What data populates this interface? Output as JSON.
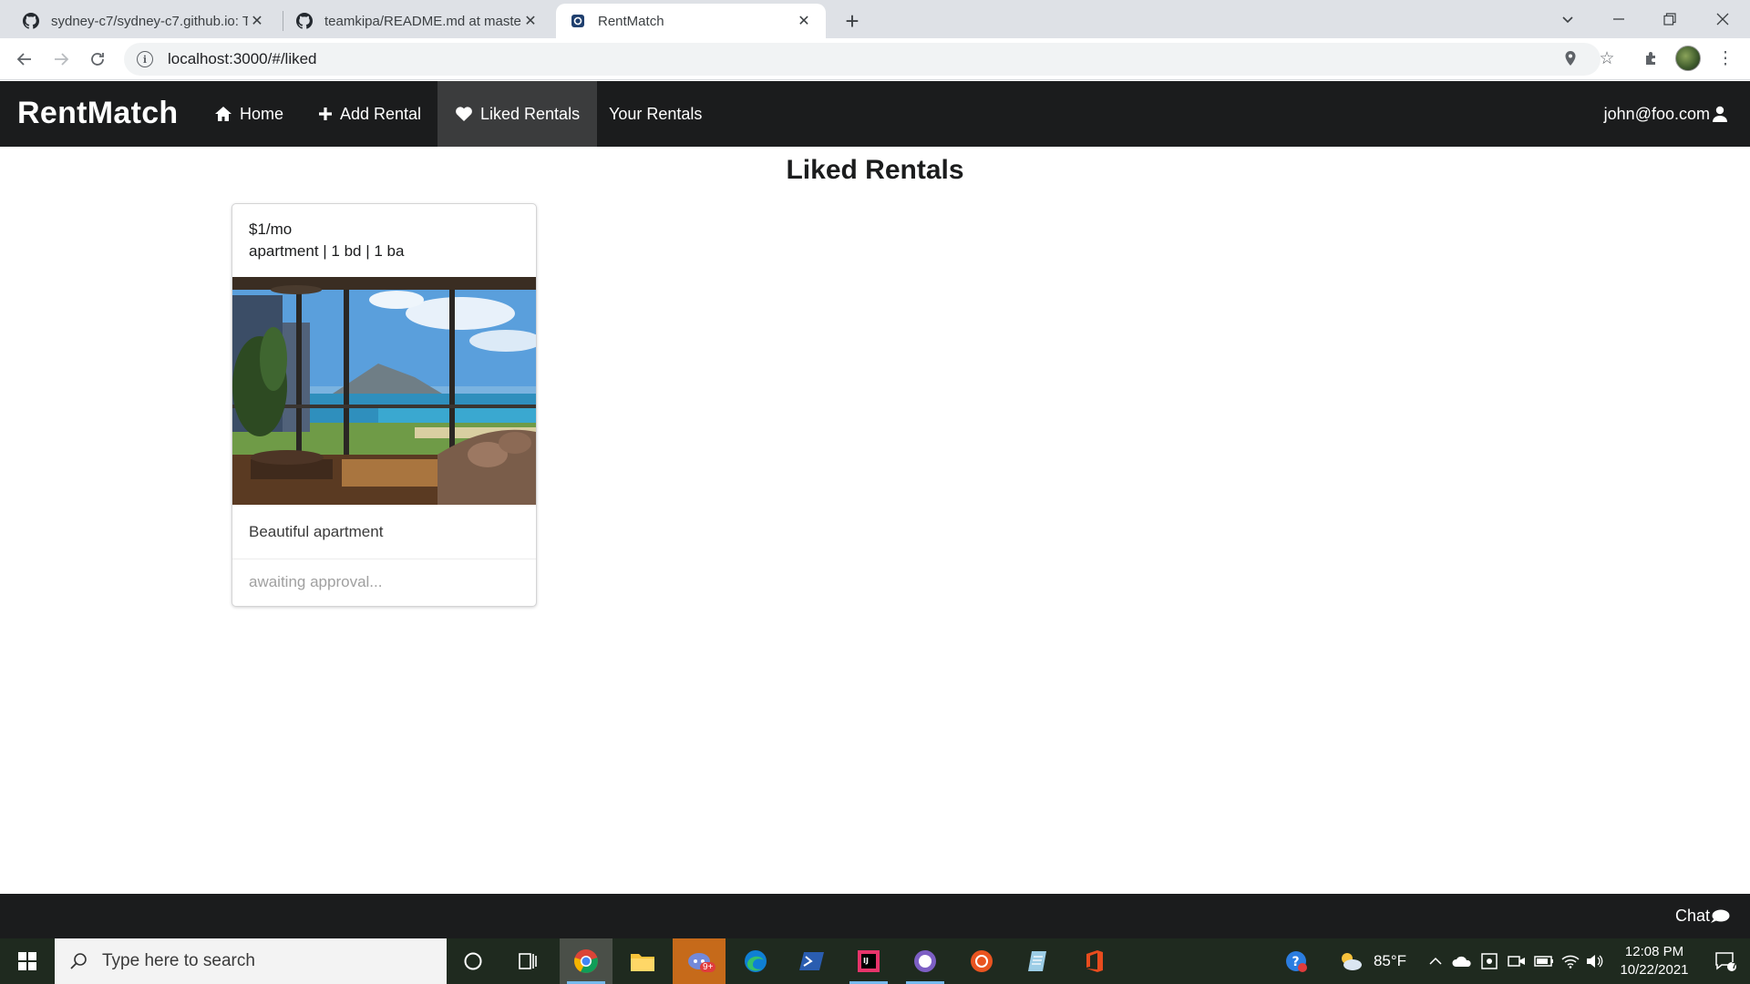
{
  "browser": {
    "tabs": [
      {
        "title": "sydney-c7/sydney-c7.github.io: T",
        "icon": "github-icon"
      },
      {
        "title": "teamkipa/README.md at master",
        "icon": "github-icon"
      },
      {
        "title": "RentMatch",
        "icon": "app-favicon"
      }
    ],
    "url": "localhost:3000/#/liked"
  },
  "app": {
    "brand": "RentMatch",
    "nav": {
      "home": "Home",
      "add_rental": "Add Rental",
      "liked_rentals": "Liked Rentals",
      "your_rentals": "Your Rentals"
    },
    "user": "john@foo.com",
    "page_title": "Liked Rentals",
    "rentals": [
      {
        "price": "$1/mo",
        "details": "apartment | 1 bd | 1 ba",
        "description": "Beautiful apartment",
        "status": "awaiting approval..."
      }
    ],
    "footer": {
      "chat": "Chat"
    }
  },
  "taskbar": {
    "search_placeholder": "Type here to search",
    "weather": "85°F",
    "time": "12:08 PM",
    "date": "10/22/2021",
    "notifications": "7",
    "badge_discord": "9+"
  }
}
